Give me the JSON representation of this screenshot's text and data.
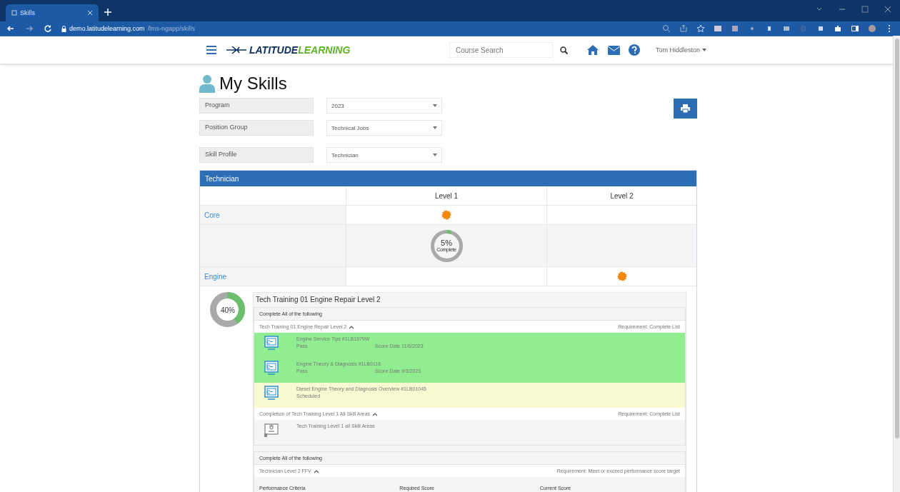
{
  "browser": {
    "tab": {
      "title": "Skills"
    },
    "url_host": "demo.latitudelearning.com",
    "url_path": "/lms-ngapp/skills"
  },
  "header": {
    "logo": [
      "LATITUDE",
      "LEARNING"
    ],
    "search": {
      "placeholder": "Course Search"
    },
    "user": "Tom Hiddleston"
  },
  "page": {
    "title": "My Skills",
    "filters": [
      {
        "label": "Program",
        "value": "2023"
      },
      {
        "label": "Position Group",
        "value": "Technical Jobs"
      },
      {
        "label": "Skill Profile",
        "value": "Technician"
      }
    ]
  },
  "profile": {
    "title": "Technician",
    "columns": [
      "Level 1",
      "Level 2"
    ],
    "rows": [
      {
        "kind": "area",
        "name": "Core",
        "cells": [
          {
            "dot": true
          },
          {
            "dot": false
          }
        ]
      },
      {
        "kind": "progress",
        "level": 0.05,
        "percent": "5%",
        "caption": "Complete"
      },
      {
        "kind": "area",
        "name": "Engine",
        "cells": [
          {
            "dot": false
          },
          {
            "dot": true
          }
        ]
      }
    ],
    "detail": {
      "level": 0.4,
      "percent": "40%",
      "title": "Tech Training 01 Engine Repair Level 2",
      "groups": [
        {
          "heading": "Complete All of the following",
          "sections": [
            {
              "title": "Tech Training 01 Engine Repair Level 2",
              "expanded": true,
              "requirement": "Requirement: Complete List",
              "items": [
                {
                  "kind": "course",
                  "color": "#90ee90",
                  "name": "Engine Service Tips #1LB1979W",
                  "status_text": "Pass",
                  "score_date": "Score Date 11/6/2023"
                },
                {
                  "kind": "course",
                  "color": "#90ee90",
                  "name": "Engine Theory & Diagnosis #1LB0116",
                  "status_text": "Pass",
                  "score_date": "Score Date 9/3/2023"
                },
                {
                  "kind": "course",
                  "color": "#fafad2",
                  "name": "Diesel Engine Theory and Diagnosis Overview #1LB01045",
                  "status_text": "Scheduled"
                }
              ]
            },
            {
              "title": "Completion of Tech Training Level 1 All Skill Areas",
              "expanded": true,
              "requirement": "Requirement: Complete List",
              "items": [
                {
                  "kind": "certificate",
                  "name": "Tech Training Level 1 all Skill Areas"
                }
              ]
            }
          ]
        },
        {
          "heading": "Complete All of the following",
          "sections": [
            {
              "title": "Technician Level 2 FFV",
              "expanded": true,
              "requirement": "Requirement: Meet or exceed performance score target",
              "columns": [
                "Performance Criteria",
                "Required Score",
                "Current Score"
              ]
            }
          ]
        }
      ]
    }
  }
}
